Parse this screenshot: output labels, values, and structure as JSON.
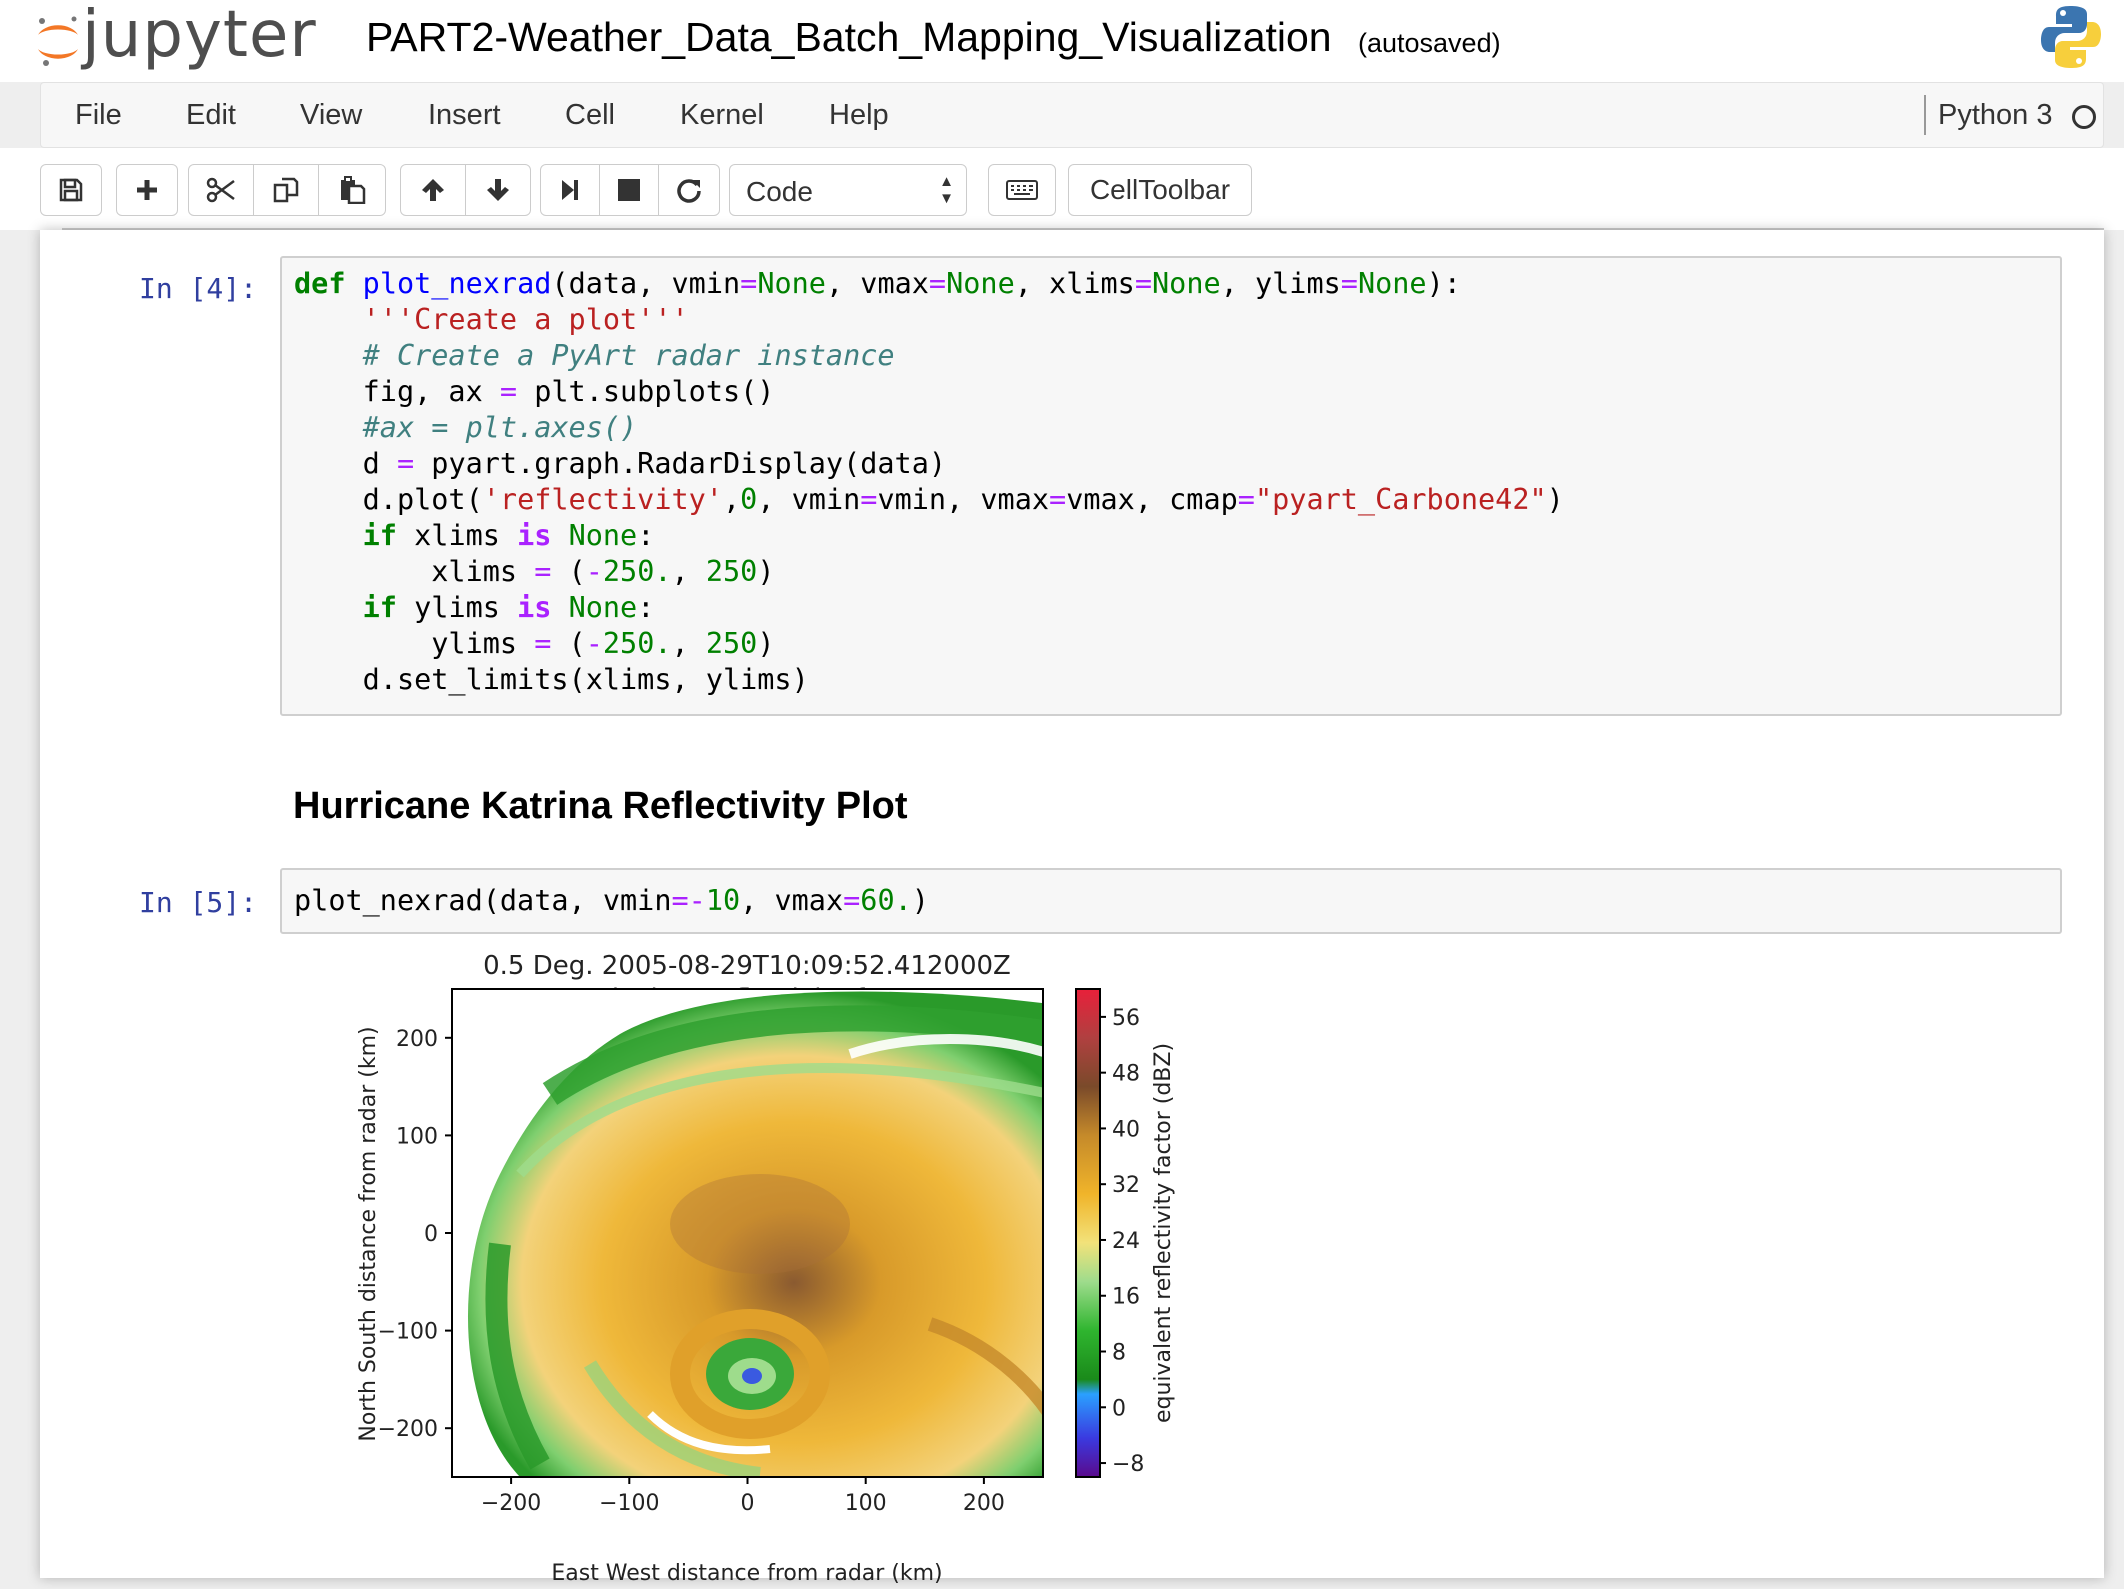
{
  "header": {
    "logo_text": "jupyter",
    "notebook_name": "PART2-Weather_Data_Batch_Mapping_Visualization",
    "autosave_status": "(autosaved)"
  },
  "menubar": {
    "items": [
      "File",
      "Edit",
      "View",
      "Insert",
      "Cell",
      "Kernel",
      "Help"
    ],
    "kernel_name": "Python 3"
  },
  "toolbar": {
    "cell_type": "Code",
    "celltoolbar_label": "CellToolbar"
  },
  "cells": {
    "cell1": {
      "prompt": "In [4]:",
      "code": [
        "def plot_nexrad(data, vmin=None, vmax=None, xlims=None, ylims=None):",
        "    '''Create a plot'''",
        "    # Create a PyArt radar instance",
        "    fig, ax = plt.subplots()",
        "    #ax = plt.axes()",
        "    d = pyart.graph.RadarDisplay(data)",
        "    d.plot('reflectivity',0, vmin=vmin, vmax=vmax, cmap=\"pyart_Carbone42\")",
        "    if xlims is None:",
        "        xlims = (-250., 250)",
        "    if ylims is None:",
        "        ylims = (-250., 250)",
        "    d.set_limits(xlims, ylims)"
      ]
    },
    "markdown": {
      "heading": "Hurricane Katrina Reflectivity Plot"
    },
    "cell2": {
      "prompt": "In [5]:",
      "code": "plot_nexrad(data, vmin=-10, vmax=60.)"
    }
  },
  "chart_data": {
    "type": "heatmap",
    "title": "0.5 Deg. 2005-08-29T10:09:52.412000Z",
    "subtitle": "Equivalent reflectivity factor",
    "xlabel": "East West distance from radar (km)",
    "ylabel": "North South distance from radar (km)",
    "xlim": [
      -250,
      250
    ],
    "ylim": [
      -250,
      250
    ],
    "x_ticks": [
      -200,
      -100,
      0,
      100,
      200
    ],
    "y_ticks": [
      200,
      100,
      0,
      -100,
      -200
    ],
    "x_tick_labels": [
      "−200",
      "−100",
      "0",
      "100",
      "200"
    ],
    "y_tick_labels": [
      "200",
      "100",
      "0",
      "−100",
      "−200"
    ],
    "colorbar": {
      "label": "equivalent reflectivity factor (dBZ)",
      "range": [
        -10,
        60
      ],
      "ticks": [
        56,
        48,
        40,
        32,
        24,
        16,
        8,
        0,
        -8
      ],
      "tick_labels": [
        "56",
        "48",
        "40",
        "32",
        "24",
        "16",
        "8",
        "0",
        "−8"
      ]
    },
    "colormap": [
      "#5a0a8c",
      "#3a3ae0",
      "#2aa0ff",
      "#1a8a1a",
      "#2fb52f",
      "#9edc8c",
      "#f2d65a",
      "#f0b42a",
      "#c58a2a",
      "#7a4a2a",
      "#b04040",
      "#e8203a"
    ]
  }
}
